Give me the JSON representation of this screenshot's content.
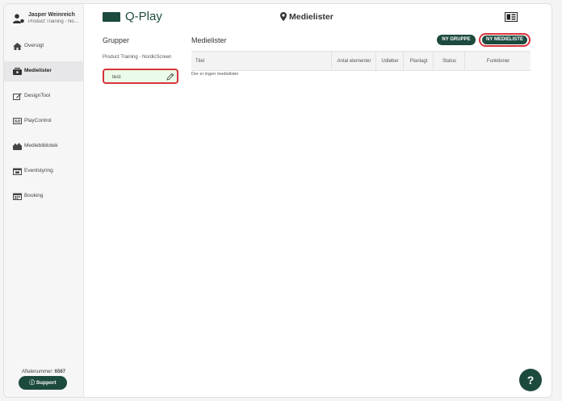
{
  "app": {
    "logo_text": "Q-Play",
    "brand_color": "#1d4a3f"
  },
  "user": {
    "name": "Jasper Weinreich",
    "org": "Product Training - No…",
    "icon": "user-icon"
  },
  "sidebar": {
    "items": [
      {
        "label": "Oversigt",
        "icon": "home-icon",
        "active": false
      },
      {
        "label": "Medielister",
        "icon": "playlist-icon",
        "active": true
      },
      {
        "label": "DesignTool",
        "icon": "design-edit-icon",
        "active": false
      },
      {
        "label": "PlayControl",
        "icon": "monitor-icon",
        "active": false
      },
      {
        "label": "Mediebibliotek",
        "icon": "media-library-icon",
        "active": false
      },
      {
        "label": "Eventstyring",
        "icon": "calendar-event-icon",
        "active": false
      },
      {
        "label": "Booking",
        "icon": "calendar-grid-icon",
        "active": false
      }
    ],
    "agreement_label": "Aftalenummer:",
    "agreement_number": "6567",
    "support_label": "Support"
  },
  "header": {
    "title": "Medielister",
    "title_icon": "location-pin-icon",
    "layout_icon": "layout-icon"
  },
  "groups": {
    "heading": "Grupper",
    "items": [
      "Product Training - NordicScreen"
    ],
    "new_group_value": "test"
  },
  "lists": {
    "heading": "Medielister",
    "new_group_button": "NY GRUPPE",
    "new_list_button": "NY MEDIELISTE",
    "columns": [
      "Titel",
      "Antal elementer",
      "Udløber",
      "Planlagt",
      "Status",
      "Funktioner"
    ],
    "empty_message": "Der er ingen medielister"
  },
  "help": {
    "label": "?"
  },
  "colors": {
    "highlight": "#d8333a",
    "new_group_bg": "#eafbe9"
  }
}
